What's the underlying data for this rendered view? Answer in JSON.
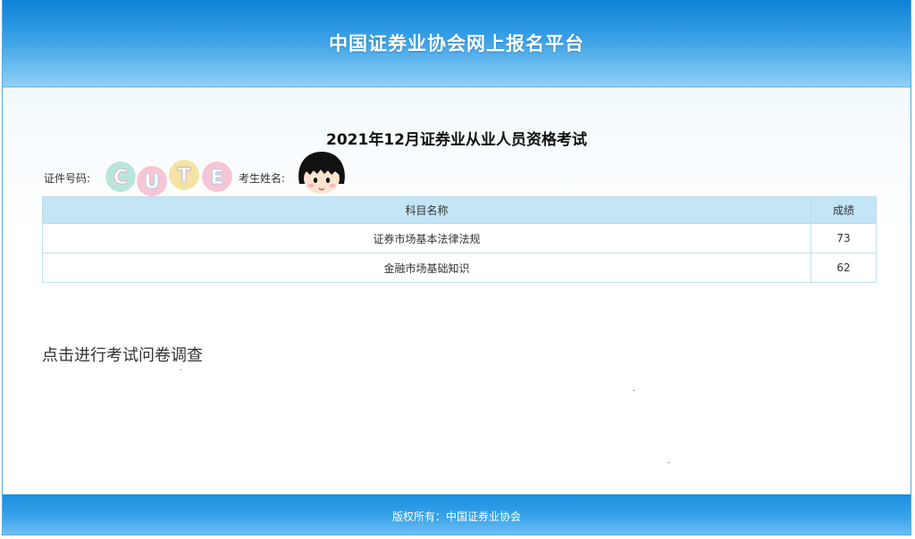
{
  "header": {
    "title": "中国证券业协会网上报名平台"
  },
  "exam": {
    "title": "2021年12月证券业从业人员资格考试"
  },
  "candidate": {
    "id_label": "证件号码:",
    "name_label": "考生姓名:"
  },
  "stickers": {
    "cute_letters": [
      "C",
      "U",
      "T",
      "E"
    ],
    "cute_colors": [
      "#b9e6dc",
      "#f6c6d6",
      "#f4e3a4",
      "#f6c6d6"
    ]
  },
  "scores": {
    "headers": [
      "科目名称",
      "成绩"
    ],
    "rows": [
      {
        "subject": "证券市场基本法律法规",
        "score": "73"
      },
      {
        "subject": "金融市场基础知识",
        "score": "62"
      }
    ]
  },
  "survey": {
    "link_text": "点击进行考试问卷调查"
  },
  "footer": {
    "text": "版权所有：中国证券业协会"
  },
  "colors": {
    "header_blue": "#0d82d6",
    "table_header_bg": "#c4e5f6",
    "footer_blue": "#1a8ee0"
  }
}
